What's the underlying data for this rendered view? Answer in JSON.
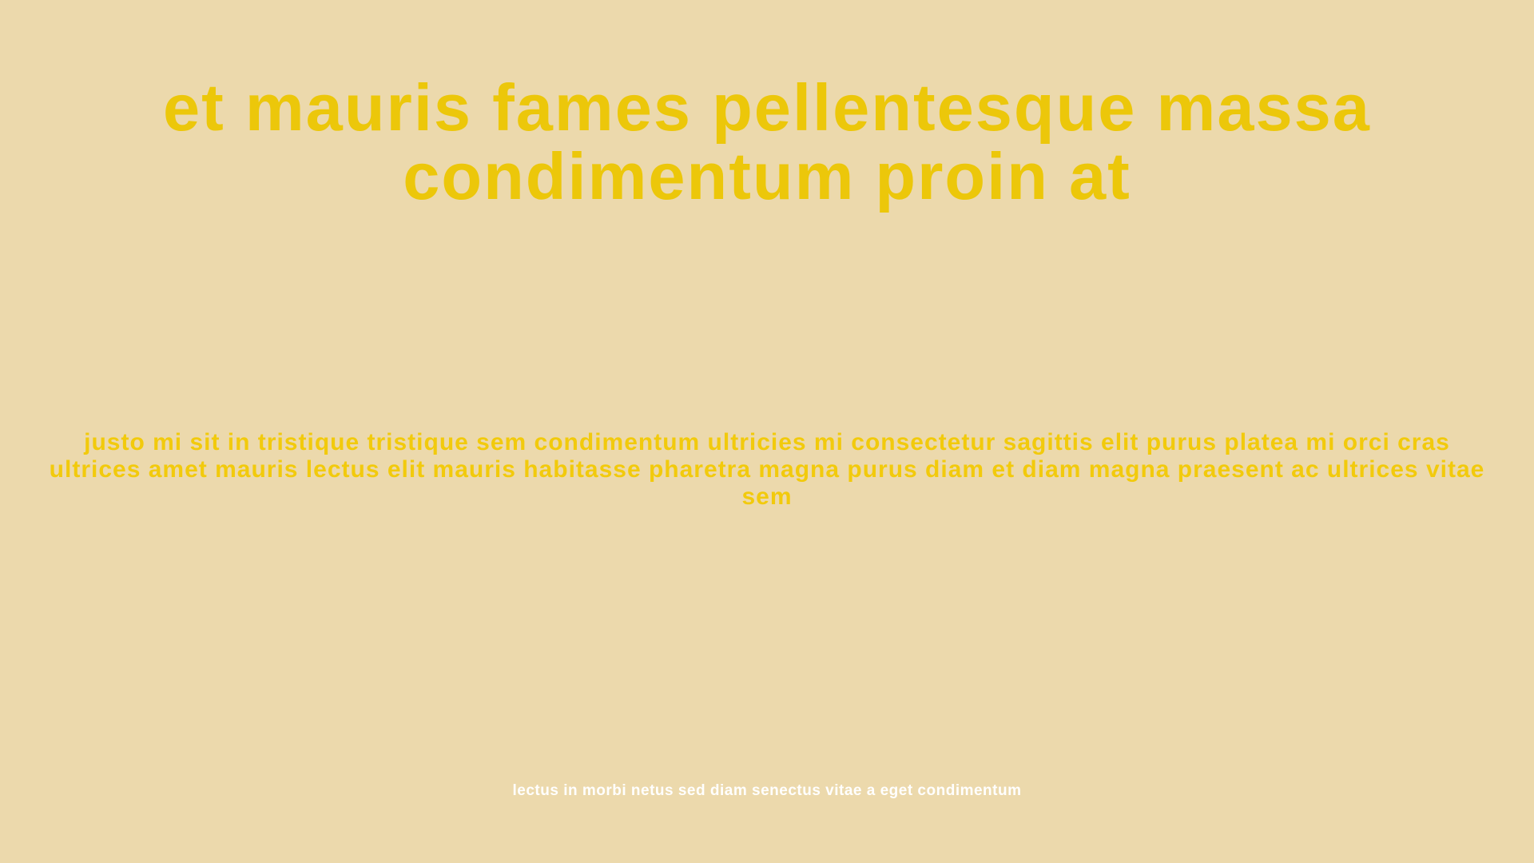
{
  "slide": {
    "headline": "et mauris fames pellentesque massa condimentum proin at",
    "body": "justo mi sit in tristique tristique sem condimentum ultricies mi consectetur sagittis elit purus platea mi orci cras ultrices amet mauris lectus elit mauris habitasse pharetra magna purus diam et diam magna praesent ac ultrices vitae sem",
    "footer": "lectus in morbi netus sed diam senectus vitae a eget condimentum"
  },
  "colors": {
    "background": "#ecd9ac",
    "headline": "#ecc70a",
    "body": "#f2ca0c",
    "footer": "#ffffff"
  }
}
